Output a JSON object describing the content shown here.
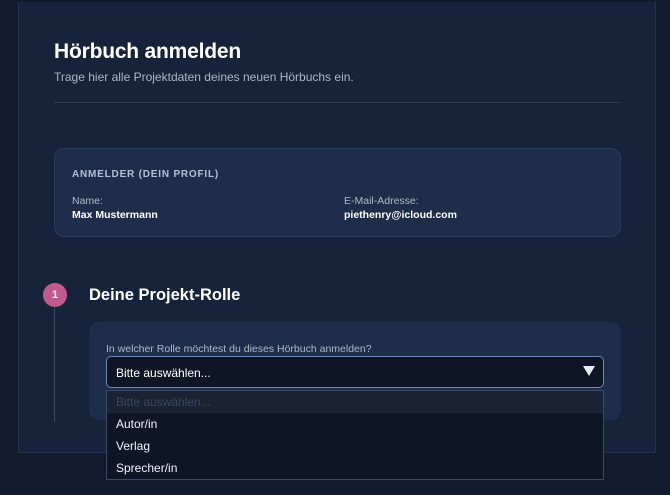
{
  "header": {
    "title": "Hörbuch anmelden",
    "subtitle": "Trage hier alle Projektdaten deines neuen Hörbuchs ein."
  },
  "profile": {
    "heading": "ANMELDER (DEIN PROFIL)",
    "name_label": "Name:",
    "name_value": "Max Mustermann",
    "email_label": "E-Mail-Adresse:",
    "email_value": "piethenry@icloud.com"
  },
  "step1": {
    "number": "1",
    "title": "Deine Projekt-Rolle",
    "question": "In welcher Rolle möchtest du dieses Hörbuch anmelden?",
    "select": {
      "value": "Bitte auswählen...",
      "options": [
        "Bitte auswählen...",
        "Autor/in",
        "Verlag",
        "Sprecher/in"
      ]
    }
  },
  "colors": {
    "background": "#111b2d",
    "panel": "#17233b",
    "card": "#1e2d4a",
    "accent": "#c05a8c",
    "select_border": "#6d86b3"
  },
  "icons": {
    "select_arrow": "triangle-down-icon"
  }
}
